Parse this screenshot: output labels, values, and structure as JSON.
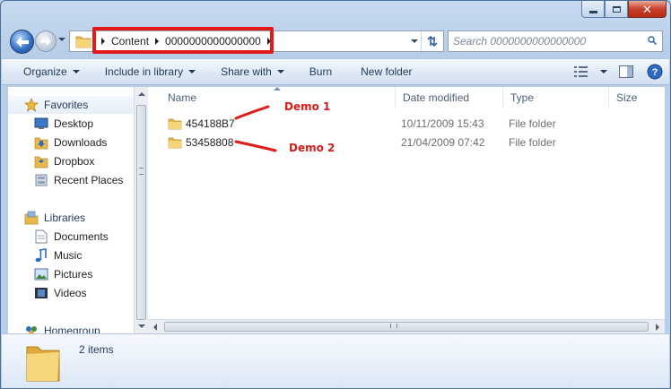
{
  "address": {
    "crumbs": [
      "Content",
      "0000000000000000"
    ]
  },
  "search": {
    "placeholder": "Search 0000000000000000"
  },
  "toolbar": {
    "organize": "Organize",
    "include_in_library": "Include in library",
    "share_with": "Share with",
    "burn": "Burn",
    "new_folder": "New folder"
  },
  "nav": {
    "favorites": "Favorites",
    "desktop": "Desktop",
    "downloads": "Downloads",
    "dropbox": "Dropbox",
    "recent_places": "Recent Places",
    "libraries": "Libraries",
    "documents": "Documents",
    "music": "Music",
    "pictures": "Pictures",
    "videos": "Videos",
    "homegroup": "Homegroup"
  },
  "columns": {
    "name": "Name",
    "date_modified": "Date modified",
    "type": "Type",
    "size": "Size"
  },
  "files": [
    {
      "name": "454188B7",
      "date": "10/11/2009 15:43",
      "type": "File folder"
    },
    {
      "name": "53458808",
      "date": "21/04/2009 07:42",
      "type": "File folder"
    }
  ],
  "annotations": {
    "demo1": "Demo 1",
    "demo2": "Demo 2"
  },
  "details": {
    "count": "2 items"
  },
  "colors": {
    "annotation_red": "#e21a1a",
    "folder_yellow": "#f0c44c"
  }
}
